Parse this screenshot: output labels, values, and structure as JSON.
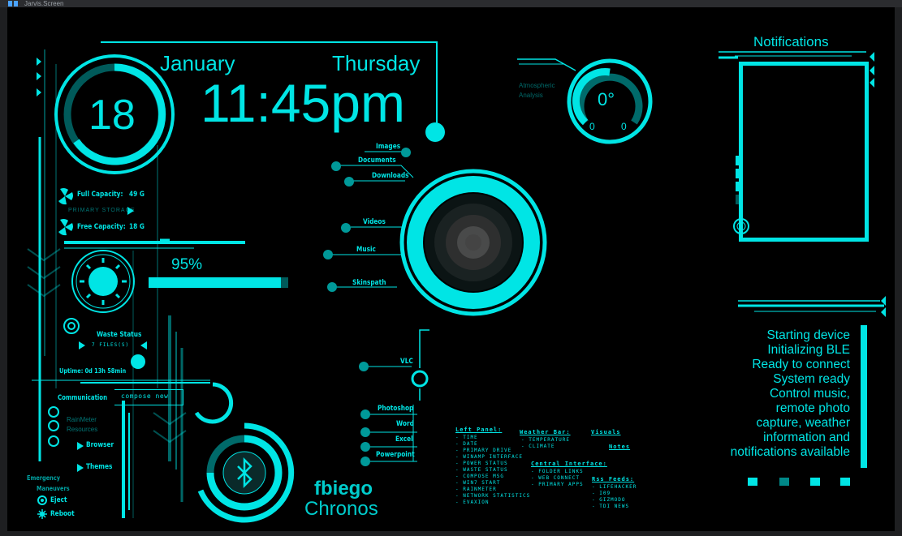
{
  "window": {
    "title": "Jarvis.Screen"
  },
  "clock": {
    "day": "18",
    "month": "January",
    "weekday": "Thursday",
    "time": "11:45pm"
  },
  "storage": {
    "full_label": "Full Capacity:",
    "full_value": "49 G",
    "primary_label": "PRIMARY STORAGE",
    "free_label": "Free Capacity:",
    "free_value": "18 G"
  },
  "power": {
    "percent_label": "95%",
    "percent": 95
  },
  "waste": {
    "title": "Waste Status",
    "files": "7 FILES(S)"
  },
  "uptime": {
    "text": "Uptime: 0d 13h 58min"
  },
  "communication": {
    "label": "Communication",
    "compose": "compose new"
  },
  "rainmeter": {
    "line1": "RainMeter",
    "line2": "Resources",
    "browser": "Browser",
    "themes": "Themes"
  },
  "emergency": {
    "line1": "Emergency",
    "line2": "Maneuvers",
    "eject": "Eject",
    "reboot": "Reboot"
  },
  "branding": {
    "line1": "fbiego",
    "line2": "Chronos"
  },
  "menu_top": [
    "Images",
    "Documents",
    "Downloads",
    "Videos",
    "Music",
    "Skinspath"
  ],
  "menu_bottom": {
    "vlc": "VLC",
    "apps": [
      "Photoshop",
      "Word",
      "Excel",
      "Powerpoint"
    ]
  },
  "weather": {
    "title_line1": "Atmospheric",
    "title_line2": "Analysis",
    "temp": "0°",
    "low": "0",
    "high": "0"
  },
  "notifications": {
    "title": "Notifications",
    "log": [
      "Starting device",
      "Initializing BLE",
      "Ready to connect",
      "System ready",
      "Control music,",
      "remote photo",
      "capture, weather",
      "information and",
      "notifications available"
    ]
  },
  "legend": {
    "left_panel": {
      "title": "Left Panel:",
      "items": [
        "- TIME",
        "- DATE",
        "- PRIMARY DRIVE",
        "- WINAMP INTERFACE",
        "- POWER STATUS",
        "- WASTE STATUS",
        "- COMPOSE MSG",
        "- WIN7 START",
        "- RAINMETER",
        "- NETWORK STATISTICS",
        "- EVAXION"
      ]
    },
    "weather_bar": {
      "title": "Weather Bar:",
      "items": [
        "- TEMPERATURE",
        "- CLIMATE"
      ]
    },
    "visuals": {
      "title": "Visuals",
      "notes": "Notes"
    },
    "central": {
      "title": "Central Interface:",
      "items": [
        "- FOLDER LINKS",
        "- WEB CONNECT",
        "- PRIMARY APPS"
      ]
    },
    "rss": {
      "title": "Rss Feeds:",
      "items": [
        "- LIFEHACKER",
        "- I09",
        "- GIZMODO",
        "- TDI NEWS"
      ]
    }
  },
  "colors": {
    "accent": "#00e5e5",
    "background": "#000000",
    "frame": "#1e1f21"
  }
}
